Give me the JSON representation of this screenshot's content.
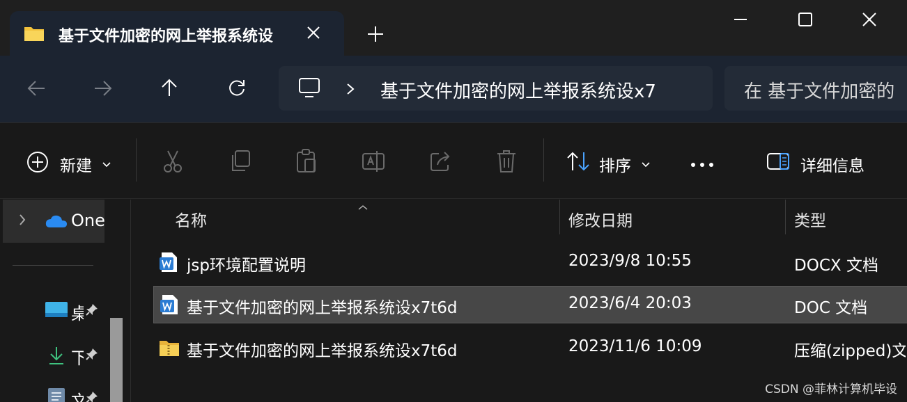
{
  "tab": {
    "title": "基于文件加密的网上举报系统设",
    "close_label": "✕",
    "new_tab_label": "+"
  },
  "address": {
    "path": "基于文件加密的网上举报系统设x7",
    "search_placeholder": "在 基于文件加密的"
  },
  "toolbar": {
    "new_label": "新建",
    "sort_label": "排序",
    "details_label": "详细信息"
  },
  "sidebar": {
    "items": [
      {
        "label": "One"
      },
      {
        "label": "桌"
      },
      {
        "label": "下"
      },
      {
        "label": "文"
      }
    ]
  },
  "columns": {
    "name": "名称",
    "modified": "修改日期",
    "type": "类型"
  },
  "files": [
    {
      "name": "jsp环境配置说明",
      "modified": "2023/9/8 10:55",
      "type": "DOCX 文档",
      "icon": "word-icon"
    },
    {
      "name": "基于文件加密的网上举报系统设x7t6d",
      "modified": "2023/6/4 20:03",
      "type": "DOC 文档",
      "icon": "word-icon",
      "selected": true
    },
    {
      "name": "基于文件加密的网上举报系统设x7t6d",
      "modified": "2023/11/6 10:09",
      "type": "压缩(zipped)文",
      "icon": "zip-folder-icon"
    }
  ],
  "watermark": "CSDN @菲林计算机毕设",
  "colors": {
    "accent": "#4aa3ff",
    "selection": "#474747",
    "nav_background": "#1c2431"
  }
}
